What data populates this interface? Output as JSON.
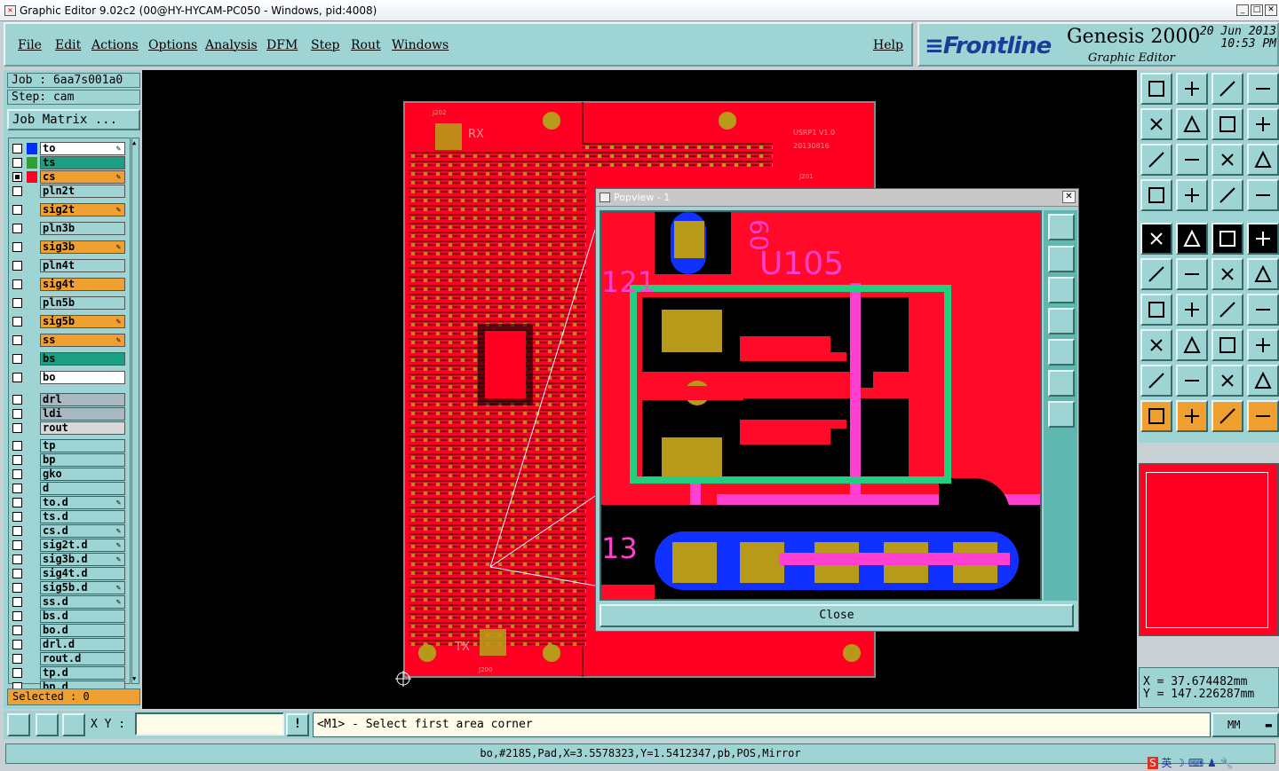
{
  "window": {
    "title": "Graphic Editor 9.02c2 (00@HY-HYCAM-PC050 - Windows, pid:4008)"
  },
  "menu": {
    "items": [
      "File",
      "Edit",
      "Actions",
      "Options",
      "Analysis",
      "DFM",
      "Step",
      "Rout",
      "Windows"
    ],
    "help": "Help"
  },
  "brand": {
    "logo_a": "Fr",
    "logo_b": "ontline",
    "product": "Genesis 2000",
    "subtitle": "Graphic Editor",
    "date": "20 Jun 2013",
    "time": "10:53 PM"
  },
  "job": {
    "job_label": "Job : 6aa7s001a0",
    "step_label": "Step: cam",
    "matrix_button": "Job Matrix ..."
  },
  "layers": [
    {
      "name": "to",
      "swatch": "#0030ff",
      "bg": "#ffffff",
      "checked": false,
      "edit": true
    },
    {
      "name": "ts",
      "swatch": "#30a030",
      "bg": "#1aa080",
      "checked": false,
      "edit": false
    },
    {
      "name": "cs",
      "swatch": "#ff0022",
      "bg": "#f0a030",
      "checked": true,
      "edit": true
    },
    {
      "name": "pln2t",
      "swatch": "",
      "bg": "#9fd4d4",
      "checked": false,
      "edit": false
    },
    {
      "name": "sig2t",
      "swatch": "",
      "bg": "#f0a030",
      "checked": false,
      "edit": true
    },
    {
      "name": "pln3b",
      "swatch": "",
      "bg": "#9fd4d4",
      "checked": false,
      "edit": false
    },
    {
      "name": "sig3b",
      "swatch": "",
      "bg": "#f0a030",
      "checked": false,
      "edit": true
    },
    {
      "name": "pln4t",
      "swatch": "",
      "bg": "#9fd4d4",
      "checked": false,
      "edit": false
    },
    {
      "name": "sig4t",
      "swatch": "",
      "bg": "#f0a030",
      "checked": false,
      "edit": false
    },
    {
      "name": "pln5b",
      "swatch": "",
      "bg": "#9fd4d4",
      "checked": false,
      "edit": false
    },
    {
      "name": "sig5b",
      "swatch": "",
      "bg": "#f0a030",
      "checked": false,
      "edit": true
    },
    {
      "name": "ss",
      "swatch": "",
      "bg": "#f0a030",
      "checked": false,
      "edit": true
    },
    {
      "name": "bs",
      "swatch": "",
      "bg": "#1aa080",
      "checked": false,
      "edit": false
    },
    {
      "name": "bo",
      "swatch": "",
      "bg": "#ffffff",
      "checked": false,
      "edit": false
    },
    {
      "name": "drl",
      "swatch": "",
      "bg": "#a8b8c0",
      "checked": false,
      "edit": false
    },
    {
      "name": "ldi",
      "swatch": "",
      "bg": "#a8b8c0",
      "checked": false,
      "edit": false
    },
    {
      "name": "rout",
      "swatch": "",
      "bg": "#d8d8d8",
      "checked": false,
      "edit": false
    },
    {
      "name": "tp",
      "swatch": "",
      "bg": "#9fd4d4",
      "checked": false,
      "edit": false
    },
    {
      "name": "bp",
      "swatch": "",
      "bg": "#9fd4d4",
      "checked": false,
      "edit": false
    },
    {
      "name": "gko",
      "swatch": "",
      "bg": "#9fd4d4",
      "checked": false,
      "edit": false
    },
    {
      "name": "d",
      "swatch": "",
      "bg": "#9fd4d4",
      "checked": false,
      "edit": false
    },
    {
      "name": "to.d",
      "swatch": "",
      "bg": "#9fd4d4",
      "checked": false,
      "edit": true
    },
    {
      "name": "ts.d",
      "swatch": "",
      "bg": "#9fd4d4",
      "checked": false,
      "edit": false
    },
    {
      "name": "cs.d",
      "swatch": "",
      "bg": "#9fd4d4",
      "checked": false,
      "edit": true
    },
    {
      "name": "sig2t.d",
      "swatch": "",
      "bg": "#9fd4d4",
      "checked": false,
      "edit": true
    },
    {
      "name": "sig3b.d",
      "swatch": "",
      "bg": "#9fd4d4",
      "checked": false,
      "edit": true
    },
    {
      "name": "sig4t.d",
      "swatch": "",
      "bg": "#9fd4d4",
      "checked": false,
      "edit": false
    },
    {
      "name": "sig5b.d",
      "swatch": "",
      "bg": "#9fd4d4",
      "checked": false,
      "edit": true
    },
    {
      "name": "ss.d",
      "swatch": "",
      "bg": "#9fd4d4",
      "checked": false,
      "edit": true
    },
    {
      "name": "bs.d",
      "swatch": "",
      "bg": "#9fd4d4",
      "checked": false,
      "edit": false
    },
    {
      "name": "bo.d",
      "swatch": "",
      "bg": "#9fd4d4",
      "checked": false,
      "edit": false
    },
    {
      "name": "drl.d",
      "swatch": "",
      "bg": "#9fd4d4",
      "checked": false,
      "edit": false
    },
    {
      "name": "rout.d",
      "swatch": "",
      "bg": "#9fd4d4",
      "checked": false,
      "edit": false
    },
    {
      "name": "tp.d",
      "swatch": "",
      "bg": "#9fd4d4",
      "checked": false,
      "edit": false
    },
    {
      "name": "bp.d",
      "swatch": "",
      "bg": "#9fd4d4",
      "checked": false,
      "edit": false
    }
  ],
  "selected": "Selected : 0",
  "board": {
    "labels": [
      "RX",
      "TX",
      "USRP1 V1.0",
      "20130816",
      "J200",
      "J201",
      "J202"
    ]
  },
  "popview": {
    "title": "Popview - 1",
    "close": "Close",
    "labels": [
      "U105",
      "121",
      "13",
      "60"
    ]
  },
  "coords": {
    "x": "X = 37.674482mm",
    "y": "Y = 147.226287mm"
  },
  "bottom": {
    "xy_label": "X Y :",
    "xy_value": "",
    "prompt": "<M1> - Select first area corner",
    "units": "MM"
  },
  "status": "bo,#2185,Pad,X=3.5578323,Y=1.5412347,pb,POS,Mirror",
  "tray": "英",
  "colors": {
    "panel": "#9fd4d4",
    "board": "#ff0022",
    "pad": "#b89a1a",
    "highlight": "#20d080",
    "trace_blue": "#1030ff",
    "magenta": "#ff40d0"
  }
}
